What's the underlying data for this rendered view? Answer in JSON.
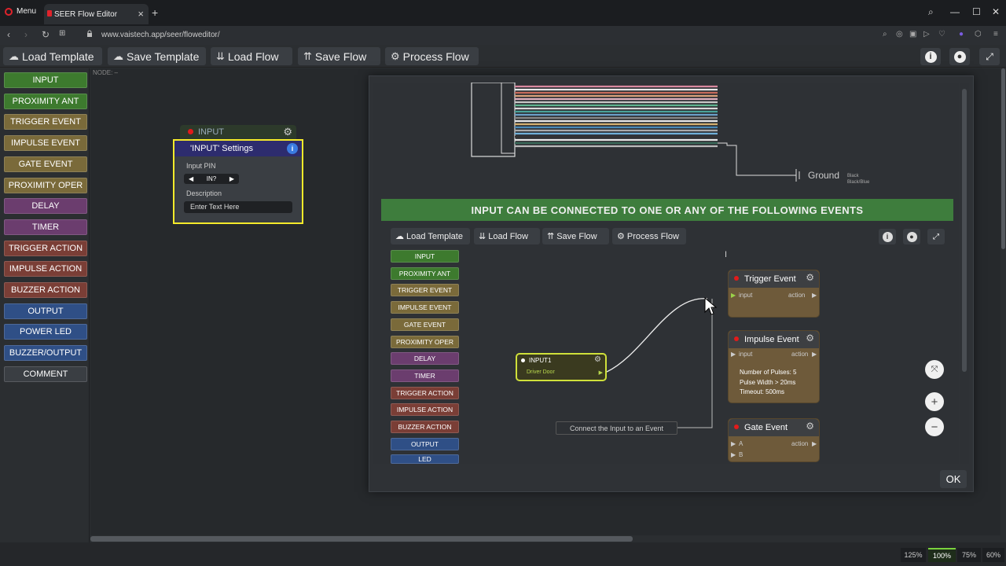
{
  "browser": {
    "menu_label": "Menu",
    "tab_title": "SEER Flow Editor",
    "url": "www.vaistech.app/seer/floweditor/"
  },
  "toolbar": {
    "load_template": "Load Template",
    "save_template": "Save Template",
    "load_flow": "Load Flow",
    "save_flow": "Save Flow",
    "process_flow": "Process Flow"
  },
  "palette": {
    "items": [
      {
        "label": "INPUT",
        "color": "#3d7a2e"
      },
      {
        "label": "PROXIMITY ANT",
        "color": "#3d7a2e"
      },
      {
        "label": "TRIGGER EVENT",
        "color": "#7a6a3a"
      },
      {
        "label": "IMPULSE EVENT",
        "color": "#7a6a3a"
      },
      {
        "label": "GATE EVENT",
        "color": "#7a6a3a"
      },
      {
        "label": "PROXIMITY OPER",
        "color": "#7a6a3a"
      },
      {
        "label": "DELAY",
        "color": "#6b3d6e"
      },
      {
        "label": "TIMER",
        "color": "#6b3d6e"
      },
      {
        "label": "TRIGGER ACTION",
        "color": "#7a3e36"
      },
      {
        "label": "IMPULSE ACTION",
        "color": "#7a3e36"
      },
      {
        "label": "BUZZER ACTION",
        "color": "#7a3e36"
      },
      {
        "label": "OUTPUT",
        "color": "#2f4f86"
      },
      {
        "label": "POWER LED",
        "color": "#2f4f86"
      },
      {
        "label": "BUZZER/OUTPUT",
        "color": "#2f4f86"
      },
      {
        "label": "COMMENT",
        "color": "#3a3e43"
      }
    ]
  },
  "canvas": {
    "node_label": "NODE: –",
    "input_node": {
      "title": "INPUT"
    },
    "settings": {
      "title": "'INPUT' Settings",
      "pin_label": "Input PIN",
      "pin_value": "IN?",
      "desc_label": "Description",
      "desc_value": "Enter Text Here"
    }
  },
  "modal": {
    "ground_label": "Ground",
    "ground_wires": "Black\nBlack/Blue",
    "banner": "INPUT CAN BE CONNECTED TO ONE OR ANY OF THE FOLLOWING EVENTS",
    "toolbar": {
      "load_template": "Load Template",
      "load_flow": "Load Flow",
      "save_flow": "Save Flow",
      "process_flow": "Process Flow"
    },
    "palette": [
      {
        "label": "INPUT",
        "color": "#3d7a2e"
      },
      {
        "label": "PROXIMITY ANT",
        "color": "#3d7a2e"
      },
      {
        "label": "TRIGGER EVENT",
        "color": "#7a6a3a"
      },
      {
        "label": "IMPULSE EVENT",
        "color": "#7a6a3a"
      },
      {
        "label": "GATE EVENT",
        "color": "#7a6a3a"
      },
      {
        "label": "PROXIMITY OPER",
        "color": "#7a6a3a"
      },
      {
        "label": "DELAY",
        "color": "#6b3d6e"
      },
      {
        "label": "TIMER",
        "color": "#6b3d6e"
      },
      {
        "label": "TRIGGER ACTION",
        "color": "#7a3e36"
      },
      {
        "label": "IMPULSE ACTION",
        "color": "#7a3e36"
      },
      {
        "label": "BUZZER ACTION",
        "color": "#7a3e36"
      },
      {
        "label": "OUTPUT",
        "color": "#2f4f86"
      },
      {
        "label": "LED",
        "color": "#2f4f86"
      }
    ],
    "input1": {
      "title": "INPUT1",
      "subtitle": "Driver Door"
    },
    "trigger_event": {
      "title": "Trigger Event",
      "input": "input",
      "action": "action"
    },
    "impulse_event": {
      "title": "Impulse Event",
      "input": "input",
      "action": "action",
      "info": [
        "Number of Pulses: 5",
        "Pulse Width > 20ms",
        "Timeout: 500ms"
      ]
    },
    "gate_event": {
      "title": "Gate Event",
      "a": "A",
      "b": "B",
      "action": "action"
    },
    "hint": "Connect the Input to an Event",
    "ok": "OK"
  },
  "zoom": {
    "levels": [
      "125%",
      "100%",
      "75%",
      "60%"
    ],
    "active": "100%"
  }
}
